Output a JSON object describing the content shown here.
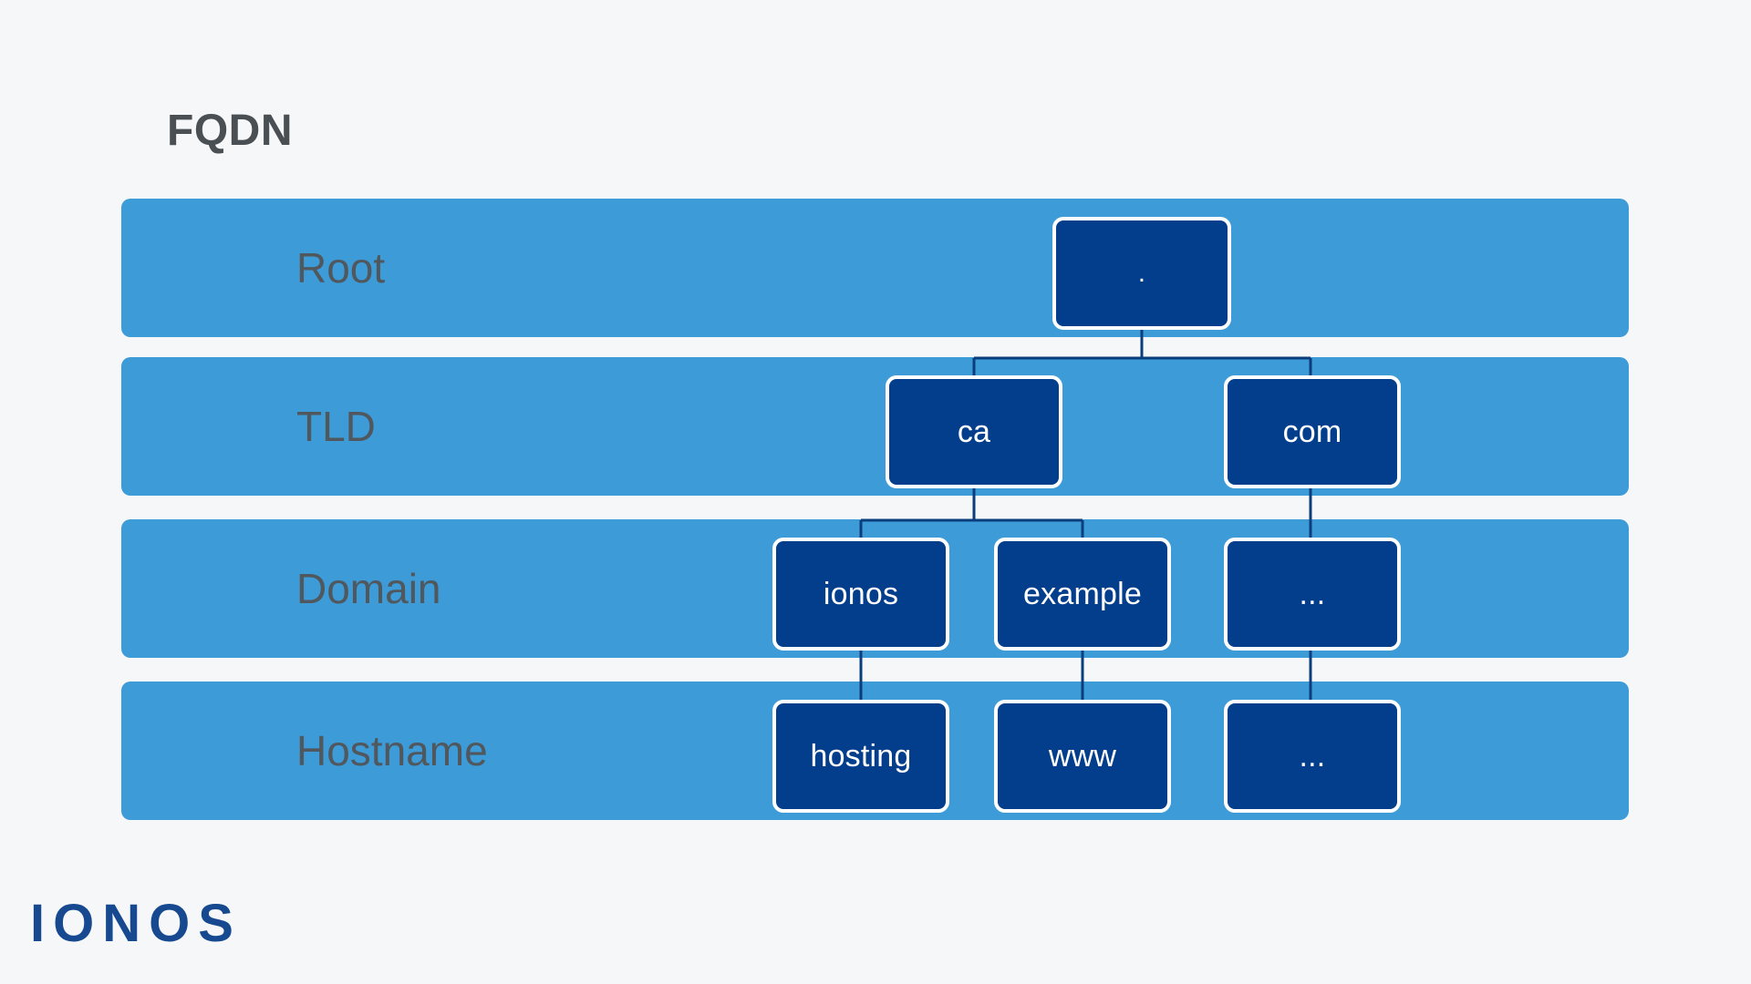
{
  "title": "FQDN",
  "brand": {
    "logo_text": "IONOS",
    "logo_color": "#16498f"
  },
  "colors": {
    "background": "#f6f7f8",
    "band": "#3d9bd8",
    "node_fill": "#023e8c",
    "node_border": "#ffffff",
    "node_text": "#ffffff",
    "band_label_text": "#50575d",
    "title_text": "#4a4f54",
    "connector_line": "#0a3d7c"
  },
  "rows": [
    {
      "id": "root",
      "label": "Root"
    },
    {
      "id": "tld",
      "label": "TLD"
    },
    {
      "id": "domain",
      "label": "Domain"
    },
    {
      "id": "hostname",
      "label": "Hostname"
    }
  ],
  "nodes": {
    "root": ".",
    "tld": {
      "ca": "ca",
      "com": "com"
    },
    "domain": {
      "ionos": "ionos",
      "example": "example",
      "more": "..."
    },
    "hostname": {
      "hosting": "hosting",
      "www": "www",
      "more": "..."
    }
  },
  "chart_data": {
    "type": "diagram",
    "title": "FQDN",
    "description": "Fully Qualified Domain Name hierarchy tree across four DNS levels",
    "levels": [
      "Root",
      "TLD",
      "Domain",
      "Hostname"
    ],
    "tree": {
      "name": ".",
      "level": "Root",
      "children": [
        {
          "name": "ca",
          "level": "TLD",
          "children": [
            {
              "name": "ionos",
              "level": "Domain",
              "children": [
                {
                  "name": "hosting",
                  "level": "Hostname"
                }
              ]
            },
            {
              "name": "example",
              "level": "Domain",
              "children": [
                {
                  "name": "www",
                  "level": "Hostname"
                }
              ]
            }
          ]
        },
        {
          "name": "com",
          "level": "TLD",
          "children": [
            {
              "name": "...",
              "level": "Domain",
              "children": [
                {
                  "name": "...",
                  "level": "Hostname"
                }
              ]
            }
          ]
        }
      ]
    }
  }
}
